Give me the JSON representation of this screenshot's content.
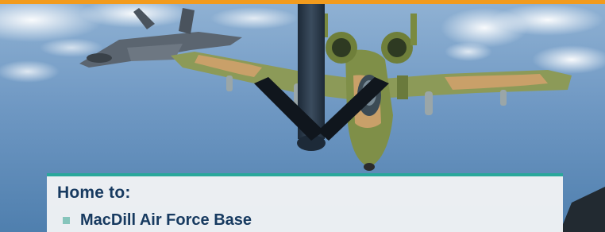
{
  "hero": {
    "image_icon": "aerial-refueling-photo",
    "colors": {
      "accent_bar": "#f29b1d",
      "card_border": "#2aa79b",
      "text": "#173a60",
      "bullet": "#86c5bc"
    }
  },
  "card": {
    "heading": "Home to:",
    "items": [
      {
        "label": "MacDill Air Force Base"
      }
    ]
  }
}
